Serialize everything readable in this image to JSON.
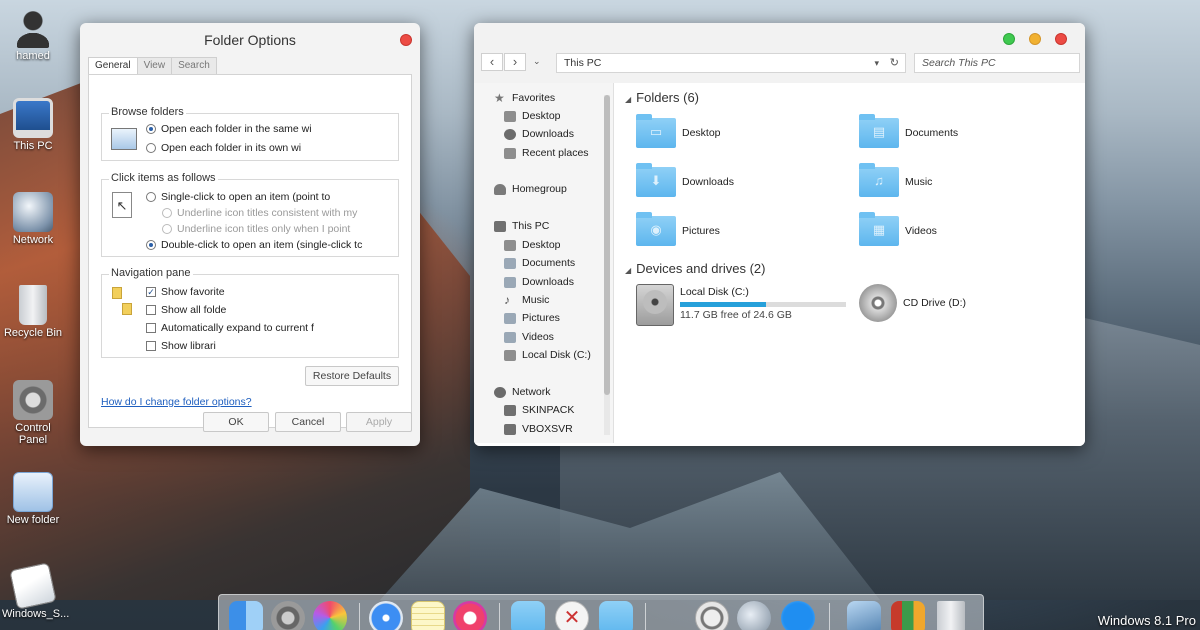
{
  "desktop": {
    "icons": [
      {
        "label": "hamed",
        "icon": "user-icon"
      },
      {
        "label": "This PC",
        "icon": "computer-icon"
      },
      {
        "label": "Network",
        "icon": "network-icon"
      },
      {
        "label": "Recycle Bin",
        "icon": "recycle-bin-icon"
      },
      {
        "label": "Control Panel",
        "icon": "control-panel-icon"
      },
      {
        "label": "New folder",
        "icon": "folder-icon"
      },
      {
        "label": "Windows_S...",
        "icon": "document-icon"
      }
    ],
    "os_label": "Windows 8.1 Pro"
  },
  "folder_options": {
    "title": "Folder Options",
    "tabs": [
      "General",
      "View",
      "Search"
    ],
    "active_tab": "General",
    "browse_folders": {
      "title": "Browse folders",
      "options": [
        "Open each folder in the same wi",
        "Open each folder in its own wi"
      ],
      "selected": 0
    },
    "click_items": {
      "title": "Click items as follows",
      "single_click": "Single-click to open an item (point to",
      "underline_consistent": "Underline icon titles consistent with my",
      "underline_point": "Underline icon titles only when I point",
      "double_click": "Double-click to open an item (single-click tc",
      "selected": "double_click"
    },
    "navigation_pane": {
      "title": "Navigation pane",
      "options": [
        {
          "label": "Show favorite",
          "checked": true
        },
        {
          "label": "Show all folde",
          "checked": false
        },
        {
          "label": "Automatically expand to current f",
          "checked": false
        },
        {
          "label": "Show librari",
          "checked": false
        }
      ]
    },
    "restore_defaults": "Restore Defaults",
    "help_link": "How do I change folder options?",
    "ok": "OK",
    "cancel": "Cancel",
    "apply": "Apply"
  },
  "explorer": {
    "address": "This PC",
    "search_placeholder": "Search This PC",
    "nav": {
      "favorites": "Favorites",
      "favorites_items": [
        "Desktop",
        "Downloads",
        "Recent places"
      ],
      "homegroup": "Homegroup",
      "this_pc": "This PC",
      "this_pc_items": [
        "Desktop",
        "Documents",
        "Downloads",
        "Music",
        "Pictures",
        "Videos",
        "Local Disk (C:)"
      ],
      "network": "Network",
      "network_items": [
        "SKINPACK",
        "VBOXSVR"
      ]
    },
    "folders_header": "Folders (6)",
    "folders": [
      "Desktop",
      "Documents",
      "Downloads",
      "Music",
      "Pictures",
      "Videos"
    ],
    "drives_header": "Devices and drives (2)",
    "local_disk": {
      "name": "Local Disk (C:)",
      "free": "11.7 GB free of 24.6 GB",
      "used_fraction": 0.52
    },
    "cd_drive": {
      "name": "CD Drive (D:)"
    }
  },
  "dock": {
    "icons": [
      "finder-icon",
      "system-preferences-icon",
      "game-center-icon",
      "safari-icon",
      "notes-icon",
      "itunes-icon",
      "folder-icon",
      "x-icon",
      "apps-folder-icon",
      "power-icon",
      "rocket-icon",
      "app-store-icon",
      "preview-icon",
      "photo-booth-icon",
      "trash-icon"
    ]
  },
  "colors": {
    "accent": "#26a0da",
    "folder": "#5db6ee",
    "close": "#ec4b44",
    "minimize": "#f1b131",
    "maximize": "#3fc950"
  }
}
